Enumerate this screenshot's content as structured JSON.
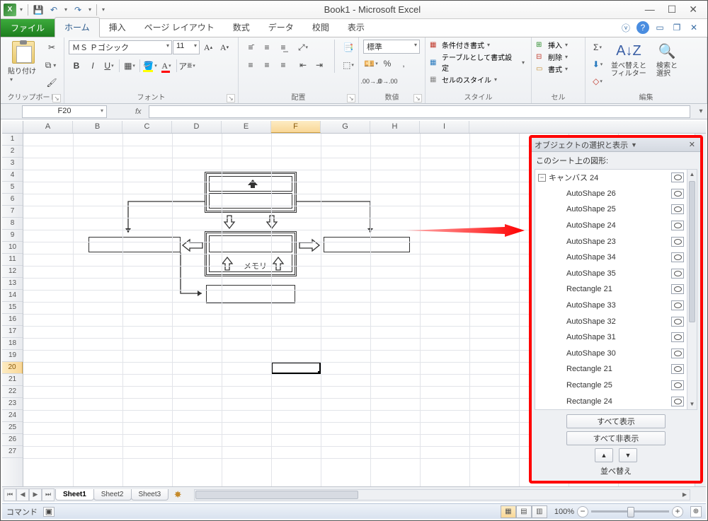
{
  "title": "Book1 - Microsoft Excel",
  "qat": {
    "save": "💾"
  },
  "tabs": {
    "file": "ファイル",
    "items": [
      "ホーム",
      "挿入",
      "ページ レイアウト",
      "数式",
      "データ",
      "校閲",
      "表示"
    ],
    "active": 0
  },
  "ribbon": {
    "clipboard": {
      "paste": "貼り付け",
      "label": "クリップボード"
    },
    "font": {
      "name": "ＭＳ Ｐゴシック",
      "size": "11",
      "label": "フォント"
    },
    "align": {
      "label": "配置"
    },
    "number": {
      "format": "標準",
      "label": "数値"
    },
    "styles": {
      "cond": "条件付き書式",
      "table": "テーブルとして書式設定",
      "cell": "セルのスタイル",
      "label": "スタイル"
    },
    "cells": {
      "insert": "挿入",
      "delete": "削除",
      "format": "書式",
      "label": "セル"
    },
    "editing": {
      "sort": "並べ替えと\nフィルター",
      "find": "検索と\n選択",
      "label": "編集"
    }
  },
  "namebox": "F20",
  "columns": [
    "A",
    "B",
    "C",
    "D",
    "E",
    "F",
    "G",
    "H",
    "I"
  ],
  "active_col": "F",
  "rows": 27,
  "active_row": 20,
  "shape_label": "メモリ",
  "selpane": {
    "title": "オブジェクトの選択と表示",
    "subtitle": "このシート上の図形:",
    "root": "キャンバス 24",
    "items": [
      "AutoShape 26",
      "AutoShape 25",
      "AutoShape 24",
      "AutoShape 23",
      "AutoShape 34",
      "AutoShape 35",
      "Rectangle 21",
      "AutoShape 33",
      "AutoShape 32",
      "AutoShape 31",
      "AutoShape 30",
      "Rectangle 21",
      "Rectangle 25",
      "Rectangle 24"
    ],
    "show_all": "すべて表示",
    "hide_all": "すべて非表示",
    "reorder": "並べ替え"
  },
  "sheets": {
    "items": [
      "Sheet1",
      "Sheet2",
      "Sheet3"
    ],
    "active": 0
  },
  "status": {
    "mode": "コマンド",
    "zoom": "100%"
  }
}
